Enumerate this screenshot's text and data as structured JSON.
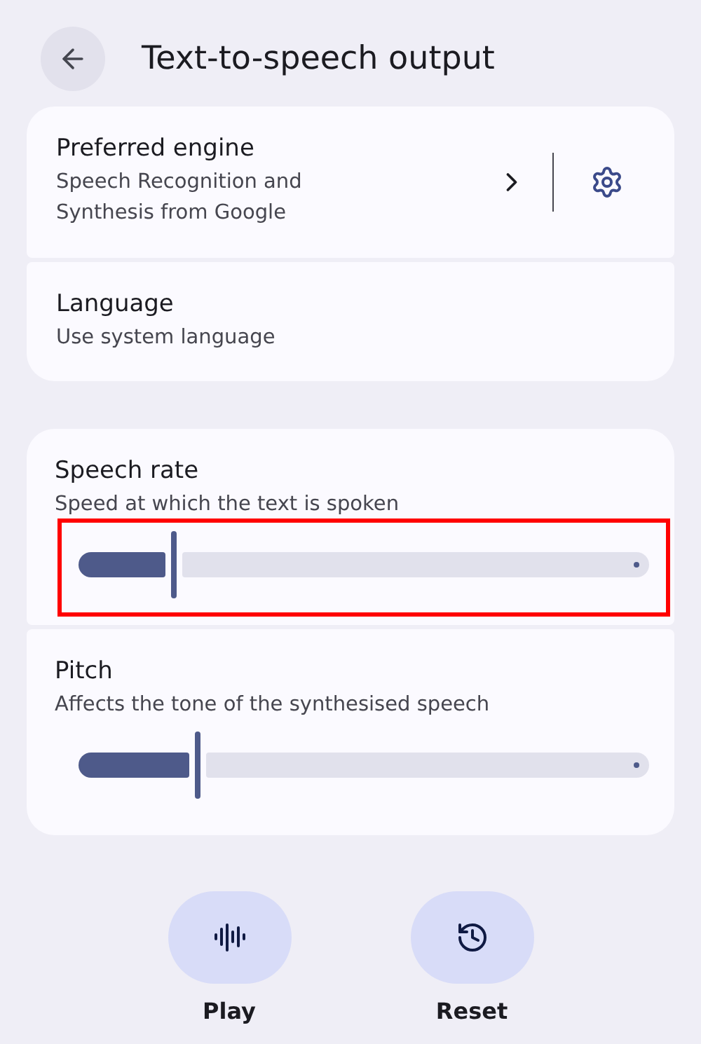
{
  "header": {
    "title": "Text-to-speech output"
  },
  "engine_card": {
    "items": [
      {
        "kind": "engine",
        "title": "Preferred engine",
        "subtitle": "Speech Recognition and Synthesis from Google"
      },
      {
        "kind": "plain",
        "title": "Language",
        "subtitle": "Use system language"
      }
    ]
  },
  "sliders": [
    {
      "title": "Speech rate",
      "subtitle": "Speed at which the text is spoken",
      "level": 0.167,
      "highlighted": true
    },
    {
      "title": "Pitch",
      "subtitle": "Affects the tone of the synthesised speech",
      "level": 0.21,
      "highlighted": false
    }
  ],
  "actions": [
    {
      "kind": "play",
      "label": "Play"
    },
    {
      "kind": "reset",
      "label": "Reset"
    }
  ]
}
